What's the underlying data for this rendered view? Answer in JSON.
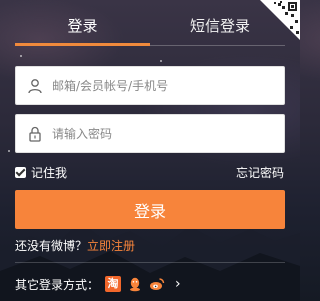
{
  "tabs": {
    "login_label": "登录",
    "sms_login_label": "短信登录"
  },
  "form": {
    "username_placeholder": "邮箱/会员帐号/手机号",
    "password_placeholder": "请输入密码",
    "remember_label": "记住我",
    "remember_checked": true,
    "forgot_label": "忘记密码",
    "submit_label": "登录"
  },
  "register": {
    "prompt": "还没有微博？",
    "link_label": "立即注册"
  },
  "other_login": {
    "label": "其它登录方式：",
    "taobao_glyph": "淘",
    "icons": [
      "taobao-icon",
      "qq-icon",
      "weibo-icon"
    ],
    "more_glyph": "›"
  },
  "colors": {
    "accent": "#f7843b",
    "active_tab_underline": "#f08a3c"
  }
}
